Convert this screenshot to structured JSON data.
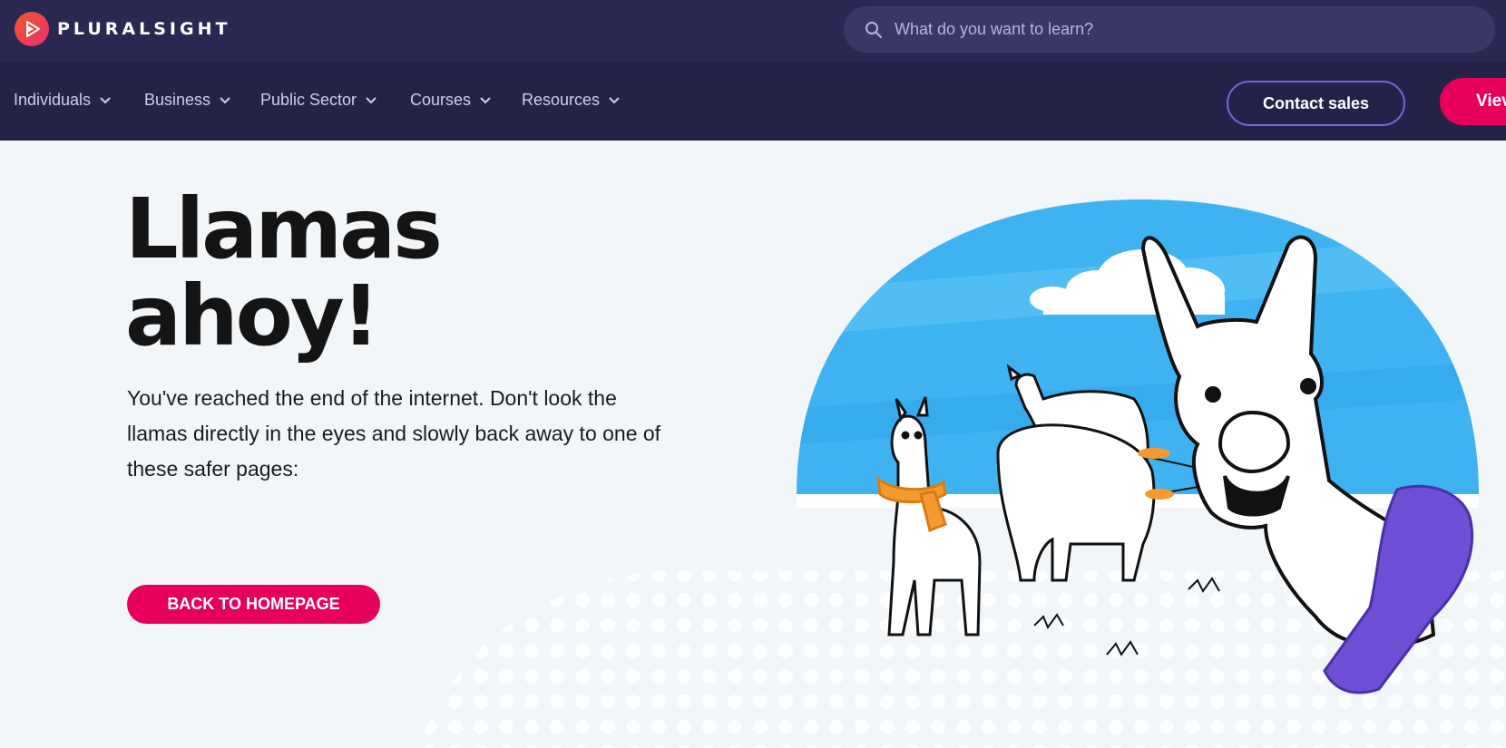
{
  "brand": {
    "name": "PLURALSIGHT",
    "icon": "pluralsight-play-logo",
    "accent": "#e6005c",
    "header_bg": "#2a2753",
    "nav_bg": "#25224a"
  },
  "search": {
    "placeholder": "What do you want to learn?",
    "icon": "search-icon"
  },
  "nav": {
    "items": [
      {
        "label": "Individuals"
      },
      {
        "label": "Business"
      },
      {
        "label": "Public Sector"
      },
      {
        "label": "Courses"
      },
      {
        "label": "Resources"
      }
    ],
    "contact_label": "Contact sales",
    "plans_label": "View plans",
    "plans_visible_label": "Viev"
  },
  "hero": {
    "title_line1": "Llamas",
    "title_line2": "ahoy!",
    "body": "You've reached the end of the internet. Don't look the llamas directly in the eyes and slowly back away to one of these safer pages:",
    "cta_label": "BACK TO HOMEPAGE"
  }
}
